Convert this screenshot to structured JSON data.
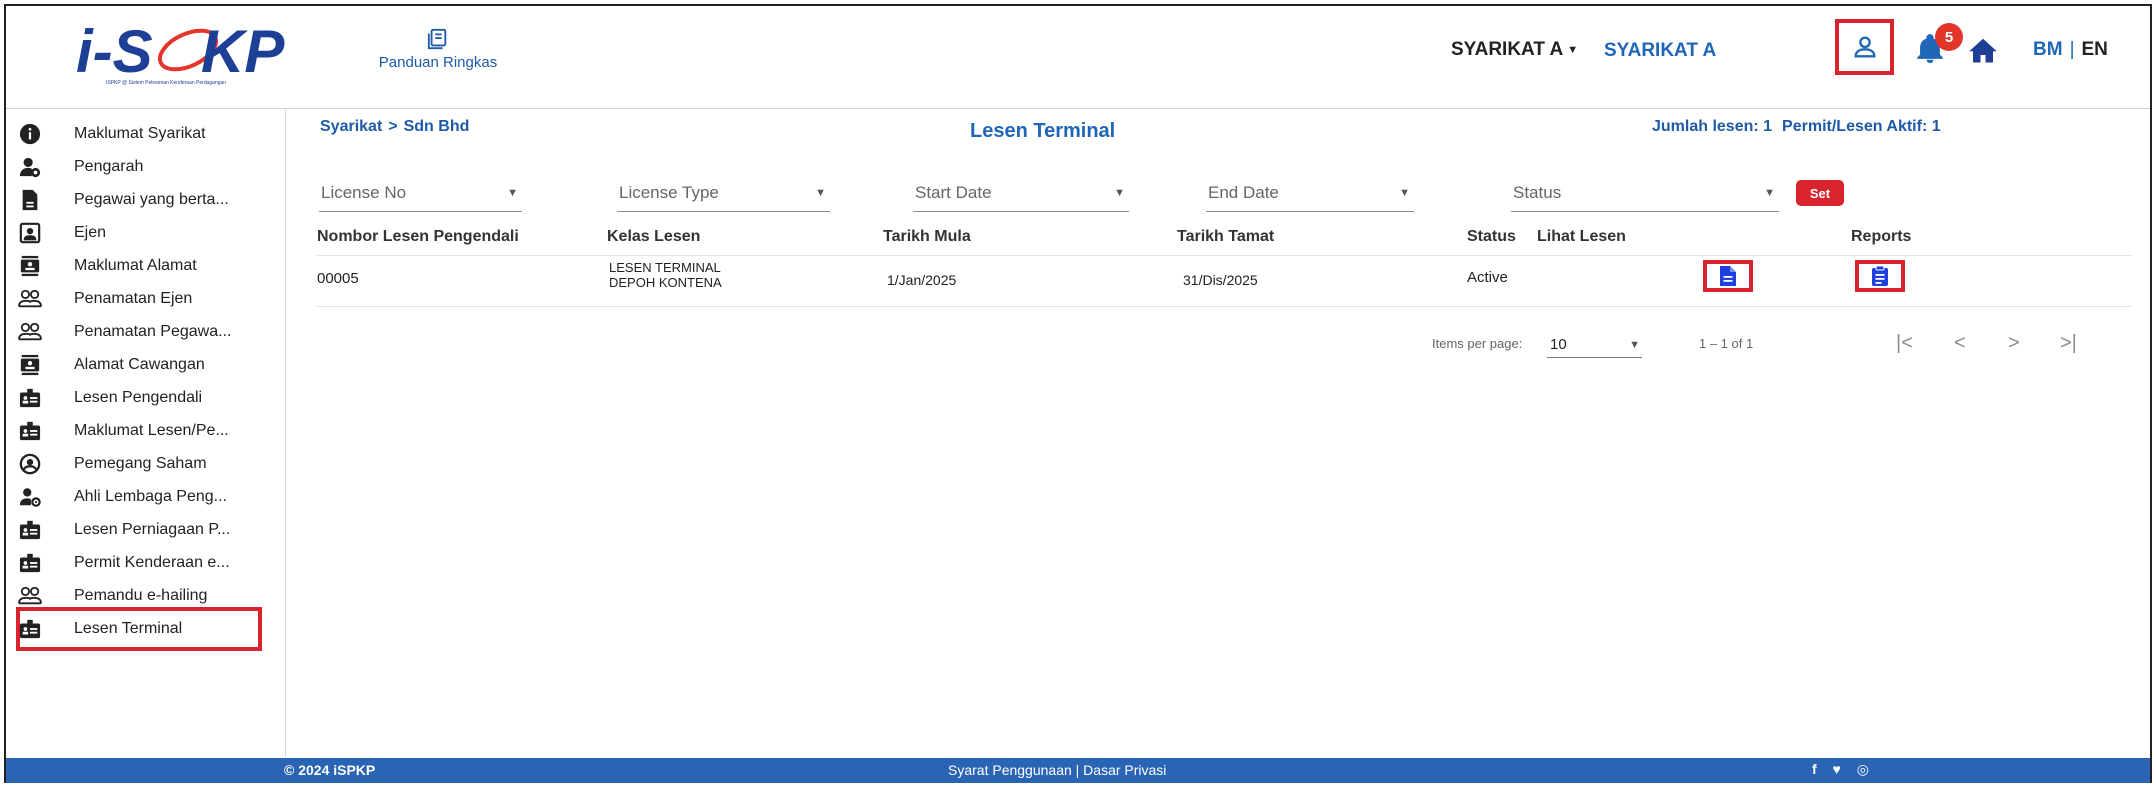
{
  "header": {
    "logo_text": "iSPKP",
    "logo_subtitle": "ISPKP @ Sistem Pelesenan Kenderaan Perdagangan",
    "guide_label": "Panduan Ringkas",
    "company_dropdown": "SYARIKAT A",
    "company_name": "SYARIKAT A",
    "notification_count": "5",
    "lang_bm": "BM",
    "lang_sep": "|",
    "lang_en": "EN"
  },
  "sidebar": {
    "items": [
      {
        "label": "Maklumat Syarikat",
        "icon": "info-icon"
      },
      {
        "label": "Pengarah",
        "icon": "user-gear-icon"
      },
      {
        "label": "Pegawai yang berta...",
        "icon": "badge-card-icon"
      },
      {
        "label": "Ejen",
        "icon": "contact-book-icon"
      },
      {
        "label": "Maklumat Alamat",
        "icon": "address-card-icon"
      },
      {
        "label": "Penamatan Ejen",
        "icon": "group-icon"
      },
      {
        "label": "Penamatan Pegawa...",
        "icon": "group-icon"
      },
      {
        "label": "Alamat Cawangan",
        "icon": "address-card-icon"
      },
      {
        "label": "Lesen Pengendali",
        "icon": "license-icon"
      },
      {
        "label": "Maklumat Lesen/Pe...",
        "icon": "license-icon"
      },
      {
        "label": "Pemegang Saham",
        "icon": "account-circle-icon"
      },
      {
        "label": "Ahli Lembaga Peng...",
        "icon": "user-settings-icon"
      },
      {
        "label": "Lesen Perniagaan P...",
        "icon": "license-icon"
      },
      {
        "label": "Permit Kenderaan e...",
        "icon": "license-icon"
      },
      {
        "label": "Pemandu e-hailing",
        "icon": "group-icon"
      },
      {
        "label": "Lesen Terminal",
        "icon": "license-icon"
      }
    ]
  },
  "main": {
    "breadcrumb": {
      "part1": "Syarikat",
      "sep": ">",
      "part2": "Sdn Bhd"
    },
    "title": "Lesen Terminal",
    "summary": {
      "total": "Jumlah lesen: 1",
      "active": "Permit/Lesen Aktif: 1"
    },
    "filters": {
      "license_no": "License No",
      "license_type": "License Type",
      "start_date": "Start Date",
      "end_date": "End Date",
      "status": "Status"
    },
    "set_label": "Set",
    "table": {
      "headers": [
        "Nombor Lesen Pengendali",
        "Kelas Lesen",
        "Tarikh Mula",
        "Tarikh Tamat",
        "Status",
        "Lihat Lesen",
        "Reports"
      ],
      "rows": [
        {
          "no": "00005",
          "kelas_line1": "LESEN TERMINAL",
          "kelas_line2": "DEPOH KONTENA",
          "mula": "1/Jan/2025",
          "tamat": "31/Dis/2025",
          "status": "Active"
        }
      ]
    },
    "pagination": {
      "items_label": "Items per page:",
      "items_value": "10",
      "range": "1 – 1 of 1",
      "first": "|<",
      "prev": "<",
      "next": ">",
      "last": ">|"
    }
  },
  "footer": {
    "copyright": "© 2024 iSPKP",
    "links": "Syarat Penggunaan | Dasar Privasi",
    "social": "f ♥ ◎"
  },
  "colors": {
    "brand_blue": "#1f66b8",
    "footer_blue": "#2a64b5",
    "highlight_red": "#d9232d",
    "action_blue": "#1f3fe0"
  }
}
